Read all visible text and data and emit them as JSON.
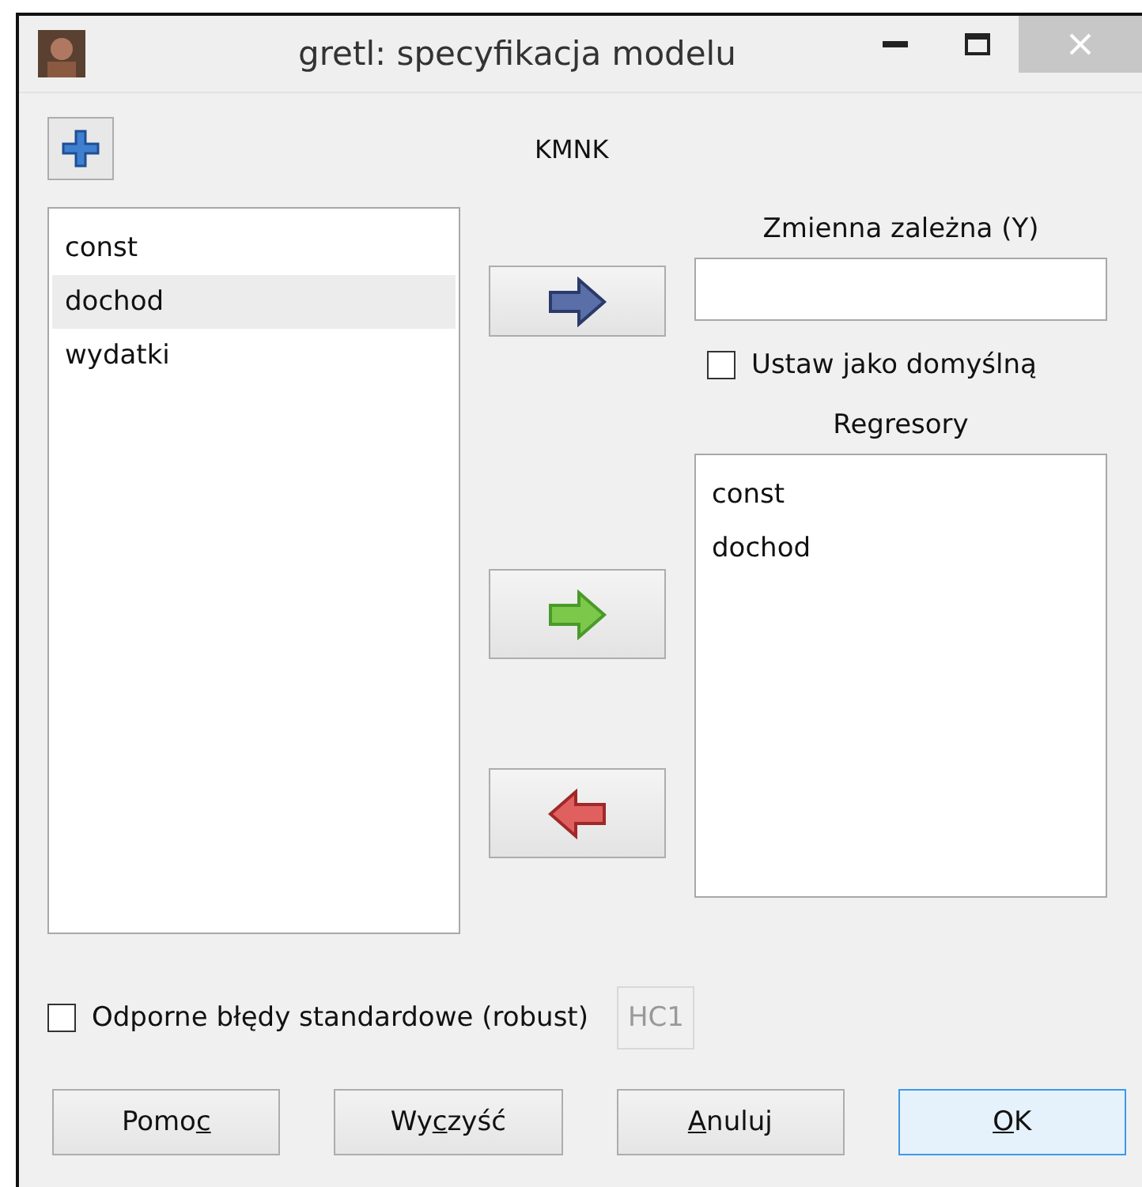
{
  "window": {
    "title": "gretl: specyfikacja modelu"
  },
  "estimator": "KMNK",
  "variables": [
    {
      "name": "const",
      "selected": false
    },
    {
      "name": "dochod",
      "selected": true
    },
    {
      "name": "wydatki",
      "selected": false
    }
  ],
  "dependent": {
    "label": "Zmienna zależna (Y)"
  },
  "set_default": {
    "label": "Ustaw jako domyślną",
    "checked": false
  },
  "regressors": {
    "label": "Regresory",
    "items": [
      "const",
      "dochod"
    ]
  },
  "robust": {
    "label": "Odporne błędy standardowe (robust)",
    "checked": false,
    "variant": "HC1"
  },
  "buttons": [
    {
      "before": "Pomo",
      "key": "c",
      "default": false
    },
    {
      "before": "Wy",
      "key": "c",
      "after": "zyść",
      "default": false
    },
    {
      "key": "A",
      "after": "nuluj",
      "default": false
    },
    {
      "key": "O",
      "after": "K",
      "default": true
    }
  ]
}
